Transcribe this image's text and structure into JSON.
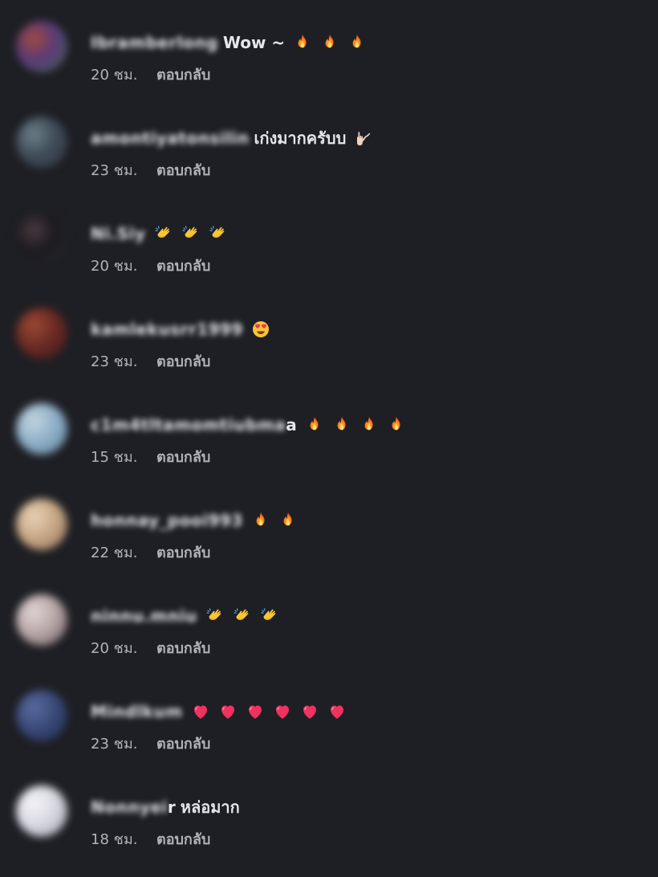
{
  "comments": [
    {
      "username": "Ibramberlong",
      "name_tail": "",
      "text": "Wow ~",
      "emojis": [
        "fire-icon",
        "fire-icon",
        "fire-icon"
      ],
      "time": "20 ชม.",
      "reply": "ตอบกลับ",
      "avatar_colors": [
        "#5b3a7a",
        "#a04a3c",
        "#3d6b4a"
      ]
    },
    {
      "username": "amontiyatonsilin",
      "name_tail": "",
      "text": "เก่งมากครับบ",
      "emojis": [
        "rock-hand-icon"
      ],
      "time": "23 ชม.",
      "reply": "ตอบกลับ",
      "avatar_colors": [
        "#3f4c58",
        "#6d7f8a",
        "#2d3640"
      ]
    },
    {
      "username": "Ni.Siy",
      "name_tail": "",
      "text": "",
      "emojis": [
        "clap-icon",
        "clap-icon",
        "clap-icon"
      ],
      "time": "20 ชม.",
      "reply": "ตอบกลับ",
      "avatar_colors": [
        "#1a1a1f",
        "#4a3a40",
        "#2a2a30"
      ]
    },
    {
      "username": "kamlekusrr1999",
      "name_tail": "",
      "text": "",
      "emojis": [
        "heart-eyes-icon"
      ],
      "time": "23 ชม.",
      "reply": "ตอบกลับ",
      "avatar_colors": [
        "#6b2a24",
        "#9b4a32",
        "#3a1a18"
      ]
    },
    {
      "username": "c1m4tltamomtiubma",
      "name_tail": "a",
      "text": "",
      "emojis": [
        "fire-icon",
        "fire-icon",
        "fire-icon",
        "fire-icon"
      ],
      "time": "15 ชม.",
      "reply": "ตอบกลับ",
      "avatar_colors": [
        "#8fb0c8",
        "#c3d4df",
        "#5f7f98"
      ]
    },
    {
      "username": "honnay_pooi993",
      "name_tail": "",
      "text": "",
      "emojis": [
        "fire-icon",
        "fire-icon"
      ],
      "time": "22 ชม.",
      "reply": "ตอบกลับ",
      "avatar_colors": [
        "#c8a886",
        "#e8d2b6",
        "#8a6e56"
      ]
    },
    {
      "username": "ninnu.mniu",
      "name_tail": "",
      "text": "",
      "emojis": [
        "clap-icon",
        "clap-icon",
        "clap-icon"
      ],
      "time": "20 ชม.",
      "reply": "ตอบกลับ",
      "avatar_colors": [
        "#b8a8a8",
        "#e0d4d4",
        "#6a5a5e"
      ]
    },
    {
      "username": "Mindlkum",
      "name_tail": "",
      "text": "",
      "emojis": [
        "heart-icon",
        "heart-icon",
        "heart-icon",
        "heart-icon",
        "heart-icon",
        "heart-icon"
      ],
      "time": "23 ชม.",
      "reply": "ตอบกลับ",
      "avatar_colors": [
        "#3a4a78",
        "#5a6aa0",
        "#1f2a4a"
      ]
    },
    {
      "username": "Nonnyei",
      "name_tail": "r",
      "text": "หล่อมาก",
      "emojis": [],
      "time": "18 ชม.",
      "reply": "ตอบกลับ",
      "avatar_colors": [
        "#d8d8e0",
        "#f4f4f8",
        "#9a9aa8"
      ]
    }
  ]
}
